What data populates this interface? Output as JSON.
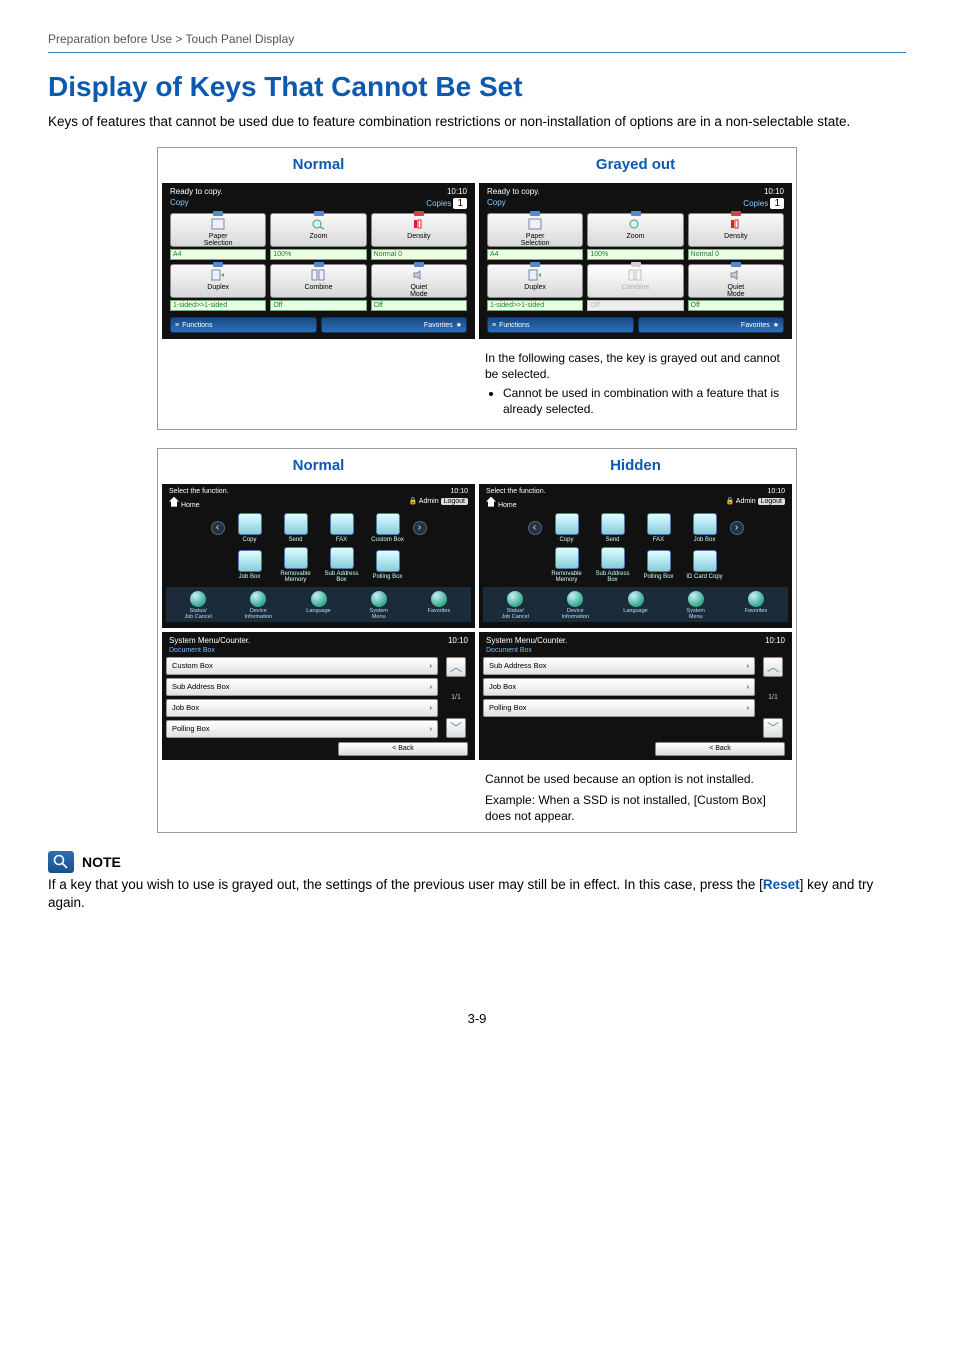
{
  "breadcrumb": "Preparation before Use > Touch Panel Display",
  "title": "Display of Keys That Cannot Be Set",
  "intro": "Keys of features that cannot be used due to feature combination restrictions or non-installation of options are in a non-selectable state.",
  "table1": {
    "left_head": "Normal",
    "right_head": "Grayed out",
    "panel": {
      "status": "Ready to copy.",
      "time": "10:10",
      "mode": "Copy",
      "copies_label": "Copies",
      "copies_value": "1",
      "row1": [
        {
          "label": "Paper\nSelection",
          "val": "A4"
        },
        {
          "label": "Zoom",
          "val": "100%"
        },
        {
          "label": "Density",
          "val": "Normal 0"
        }
      ],
      "row2": [
        {
          "label": "Duplex",
          "val": "1-sided>>1-sided"
        },
        {
          "label": "Combine",
          "val": "Off"
        },
        {
          "label": "Quiet\nMode",
          "val": "Off"
        }
      ],
      "functions": "Functions",
      "favorites": "Favorites"
    },
    "explain1": "In the following cases, the key is grayed out and cannot be selected.",
    "explain2": "Cannot be used in combination with a feature that is already selected."
  },
  "table2": {
    "left_head": "Normal",
    "right_head": "Hidden",
    "home": {
      "status": "Select the function.",
      "time": "10:10",
      "home_label": "Home",
      "admin": "Admin",
      "logout": "Logout",
      "icons_normal": [
        "Copy",
        "Send",
        "FAX",
        "Custom Box",
        "Job Box",
        "Removable Memory",
        "Sub Address Box",
        "Polling Box"
      ],
      "icons_hidden": [
        "Copy",
        "Send",
        "FAX",
        "Job Box",
        "Removable Memory",
        "Sub Address Box",
        "Polling Box",
        "ID Card Copy"
      ],
      "bottom": [
        "Status/\nJob Cancel",
        "Device\nInformation",
        "Language",
        "System\nMenu",
        "Favorites"
      ]
    },
    "menu": {
      "title": "System Menu/Counter.",
      "time": "10:10",
      "crumb": "Document Box",
      "items_normal": [
        "Custom Box",
        "Sub Address Box",
        "Job Box",
        "Polling Box"
      ],
      "items_hidden": [
        "Sub Address Box",
        "Job Box",
        "Polling Box"
      ],
      "page": "1/1",
      "back": "< Back"
    },
    "explain1": "Cannot be used because an option is not installed.",
    "explain2": "Example: When a SSD is not installed, [Custom Box] does not appear."
  },
  "note": {
    "label": "NOTE",
    "body_a": "If a key that you wish to use is grayed out, the settings of the previous user may still be in effect. In this case, press the [",
    "reset": "Reset",
    "body_b": "] key and try again."
  },
  "pageno": "3-9"
}
